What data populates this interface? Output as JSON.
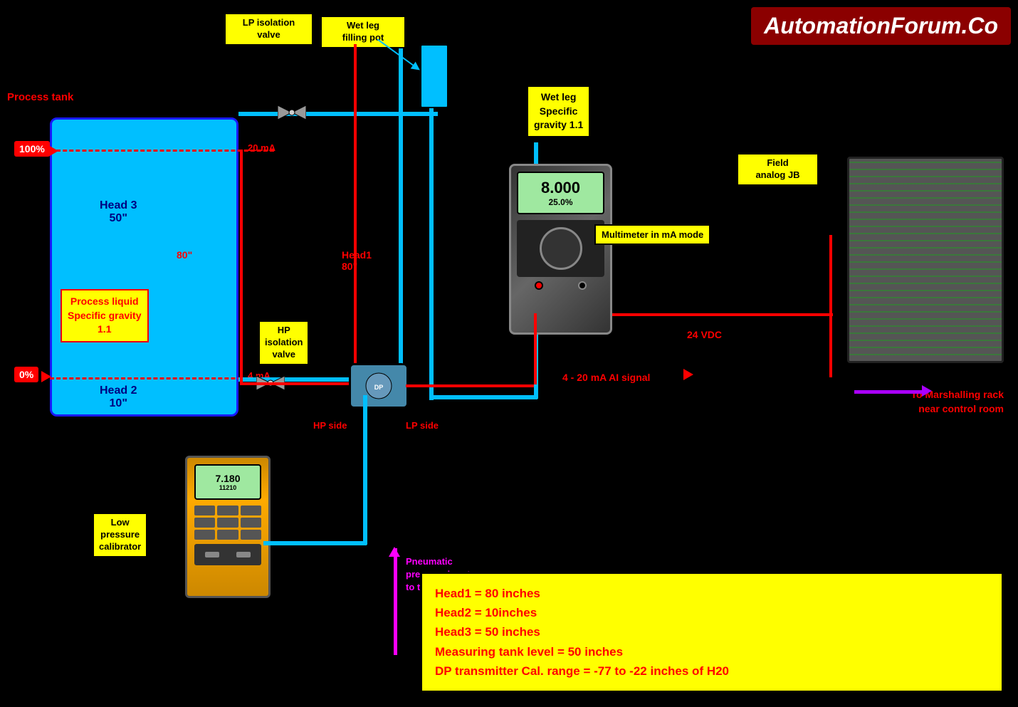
{
  "logo": {
    "text": "AutomationForum.Co"
  },
  "labels": {
    "lp_isolation_valve": "LP  isolation\nvalve",
    "wet_leg_filling_pot": "Wet leg\nfilling pot",
    "wet_leg_sg": "Wet leg\nSpecific\ngravity 1.1",
    "field_analog_jb": "Field\nanalog JB",
    "multimeter_mode": "Multimeter\nin mA mode",
    "hp_isolation_valve": "HP\nisolation\nvalve",
    "process_tank": "Process tank",
    "process_liquid_sg": "Process liquid\nSpecific gravity\n1.1",
    "low_pressure_calibrator": "Low\npressure\ncalibrator",
    "head1_label": "Head1\n80\"",
    "head2_label": "Head 2\n10\"",
    "head3_label": "Head 3\n50\"",
    "dim_80": "80\"",
    "pct_100": "100%",
    "pct_0": "0%",
    "ma_20": "20 mA",
    "ma_4": "4 mA",
    "vdc_24": "24 VDC",
    "signal_4_20": "4 - 20 mA AI signal",
    "marshalling": "To Marshalling rack\nnear control room",
    "hp_side": "HP side",
    "lp_side": "LP side",
    "pneumatic": "Pneumatic\npressure input\nto transmitter"
  },
  "multimeter": {
    "display_main": "8.000",
    "display_sub": "25.0%"
  },
  "calibrator": {
    "display_main": "7.180",
    "display_sub": "11210"
  },
  "info_box": {
    "line1": "Head1 = 80 inches",
    "line2": "Head2 = 10inches",
    "line3": "Head3 = 50 inches",
    "line4": "Measuring tank level = 50 inches",
    "line5": "DP transmitter Cal. range = -77 to -22 inches of H20"
  }
}
